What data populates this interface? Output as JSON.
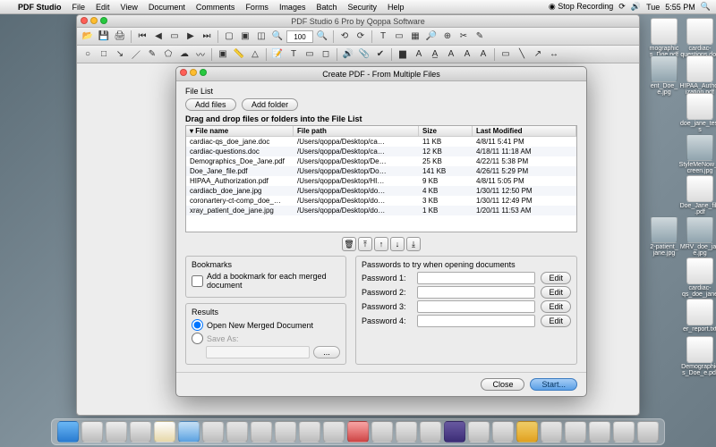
{
  "menubar": {
    "app": "PDF Studio",
    "items": [
      "File",
      "Edit",
      "View",
      "Document",
      "Comments",
      "Forms",
      "Images",
      "Batch",
      "Security",
      "Help"
    ],
    "recording": "Stop Recording",
    "day": "Tue",
    "time": "5:55 PM"
  },
  "app_window": {
    "title": "PDF Studio 6 Pro by Qoppa Software",
    "zoom": "100"
  },
  "dialog": {
    "title": "Create PDF - From Multiple Files",
    "file_list_label": "File List",
    "add_files": "Add files",
    "add_folder": "Add folder",
    "instruction": "Drag and drop files or folders into the File List",
    "columns": {
      "name": "File name",
      "path": "File path",
      "size": "Size",
      "modified": "Last Modified"
    },
    "rows": [
      {
        "name": "cardiac-qs_doe_jane.doc",
        "path": "/Users/qoppa/Desktop/ca…",
        "size": "11 KB",
        "modified": "4/8/11 5:41 PM"
      },
      {
        "name": "cardiac-questions.doc",
        "path": "/Users/qoppa/Desktop/ca…",
        "size": "12 KB",
        "modified": "4/18/11 11:18 AM"
      },
      {
        "name": "Demographics_Doe_Jane.pdf",
        "path": "/Users/qoppa/Desktop/De…",
        "size": "25 KB",
        "modified": "4/22/11 5:38 PM"
      },
      {
        "name": "Doe_Jane_file.pdf",
        "path": "/Users/qoppa/Desktop/Do…",
        "size": "141 KB",
        "modified": "4/26/11 5:29 PM"
      },
      {
        "name": "HIPAA_Authorization.pdf",
        "path": "/Users/qoppa/Desktop/HI…",
        "size": "9 KB",
        "modified": "4/8/11 5:05 PM"
      },
      {
        "name": "cardiacb_doe_jane.jpg",
        "path": "/Users/qoppa/Desktop/do…",
        "size": "4 KB",
        "modified": "1/30/11 12:50 PM"
      },
      {
        "name": "coronartery-ct-comp_doe_…",
        "path": "/Users/qoppa/Desktop/do…",
        "size": "3 KB",
        "modified": "1/30/11 12:49 PM"
      },
      {
        "name": "xray_patient_doe_jane.jpg",
        "path": "/Users/qoppa/Desktop/do…",
        "size": "1 KB",
        "modified": "1/20/11 11:53 AM"
      }
    ],
    "bookmarks": {
      "legend": "Bookmarks",
      "checkbox": "Add a bookmark for each merged document"
    },
    "results": {
      "legend": "Results",
      "open_new": "Open New Merged Document",
      "save_as": "Save As:"
    },
    "passwords": {
      "legend": "Passwords to try when opening documents",
      "labels": [
        "Password 1:",
        "Password 2:",
        "Password 3:",
        "Password 4:"
      ],
      "edit": "Edit"
    },
    "close": "Close",
    "start": "Start..."
  },
  "desktop_icons": [
    {
      "label": "mographic\ns_Doe.pdf",
      "type": "pdf"
    },
    {
      "label": "cardiac-\nquestions.doc",
      "type": "doc"
    },
    {
      "label": "HIPAA_Author\nization.pdf",
      "type": "pdf"
    },
    {
      "label": "ent_Doe_\ne.jpg",
      "type": "img"
    },
    {
      "label": "doe_jane_test\ns",
      "type": "folder"
    },
    {
      "label": "StyleMeNow_s\ncreen.jpg",
      "type": "img"
    },
    {
      "label": "Doe_Jane_file\n.pdf",
      "type": "pdf"
    },
    {
      "label": "MRV_doe_jan\ne.jpg",
      "type": "img"
    },
    {
      "label": "2-patient_\njane.jpg",
      "type": "img"
    },
    {
      "label": "cardiac-\nqs_doe_jane",
      "type": "doc"
    },
    {
      "label": "er_report.txt",
      "type": "txt"
    },
    {
      "label": "Demographic\ns_Doe_e.pdf",
      "type": "pdf"
    }
  ]
}
